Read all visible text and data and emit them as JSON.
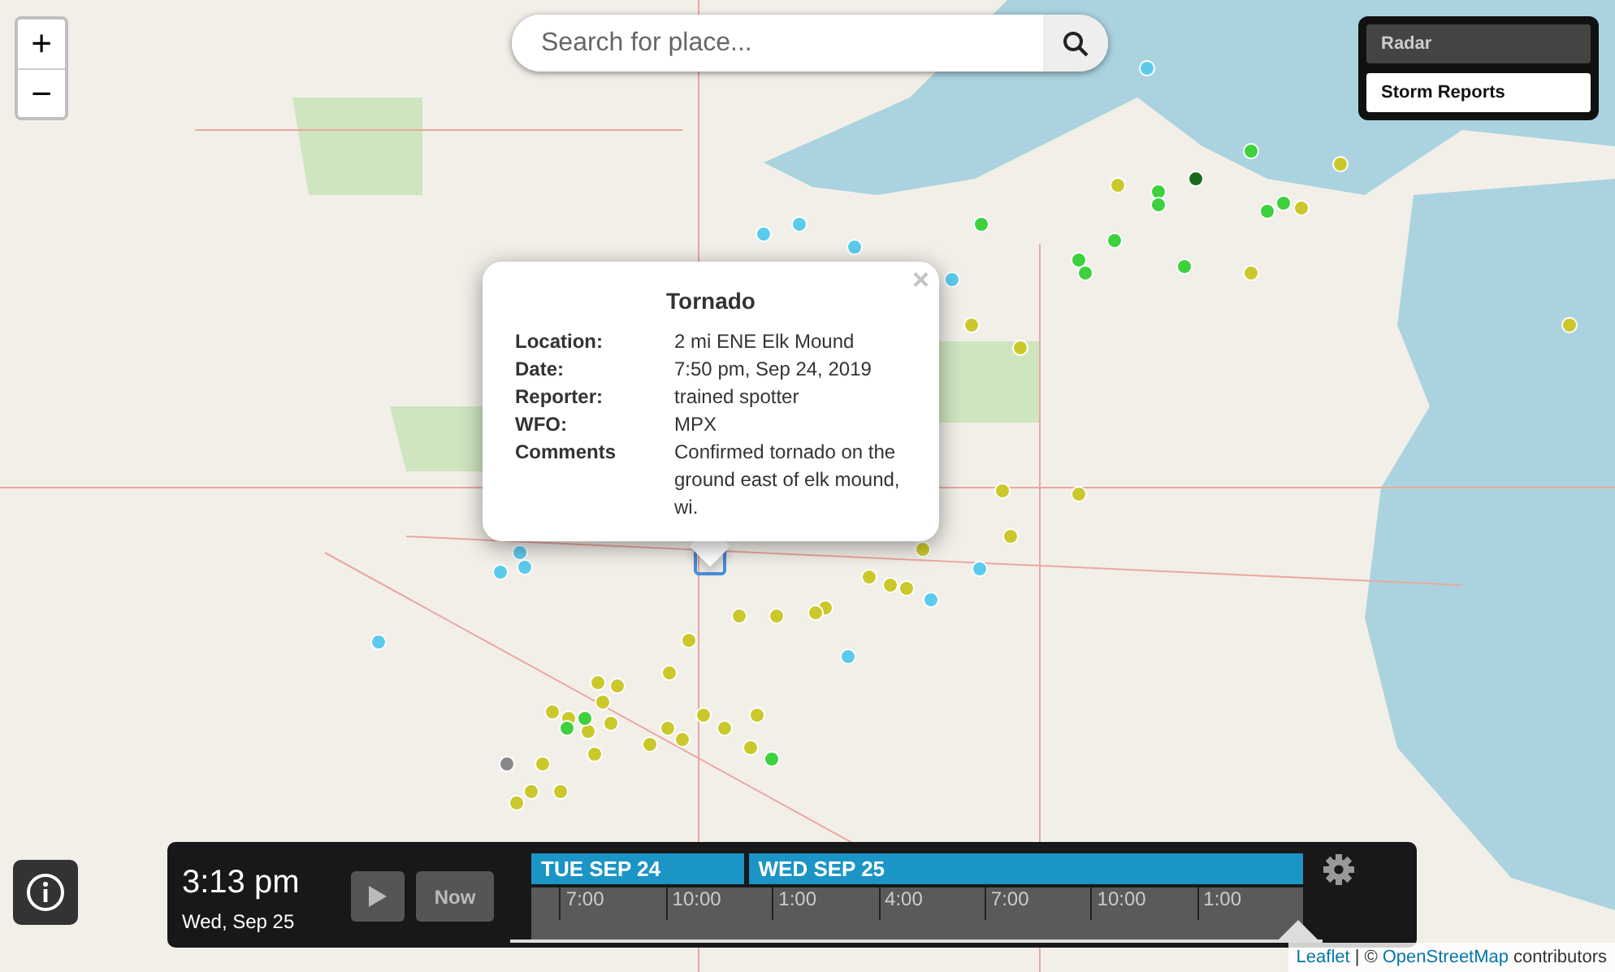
{
  "zoom_controls": [
    {
      "label": "+"
    },
    {
      "label": "−"
    }
  ],
  "search": {
    "placeholder": "Search for place..."
  },
  "layers": [
    {
      "label": "Radar",
      "selected": false
    },
    {
      "label": "Storm Reports",
      "selected": true
    }
  ],
  "popup": {
    "close": "×",
    "title": "Tornado",
    "fields": [
      {
        "label": "Location:",
        "value": "2 mi ENE Elk Mound"
      },
      {
        "label": "Date:",
        "value": "7:50 pm, Sep 24, 2019"
      },
      {
        "label": "Reporter:",
        "value": "trained spotter"
      },
      {
        "label": "WFO:",
        "value": "MPX"
      },
      {
        "label": "Comments",
        "value": "Confirmed tornado on the ground east of elk mound, wi."
      }
    ]
  },
  "timeline": {
    "time": "3:13 pm",
    "date": "Wed, Sep 25",
    "now_button": "Now",
    "days": [
      {
        "label": "TUE SEP 24"
      },
      {
        "label": "WED SEP 25"
      }
    ],
    "ticks": [
      "7:00",
      "10:00",
      "1:00",
      "4:00",
      "7:00",
      "10:00",
      "1:00"
    ],
    "level": 0.97
  },
  "attribution": {
    "leaflet": "Leaflet",
    "separator": "| ©",
    "osm": "OpenStreetMap",
    "suffix": "contributors"
  }
}
